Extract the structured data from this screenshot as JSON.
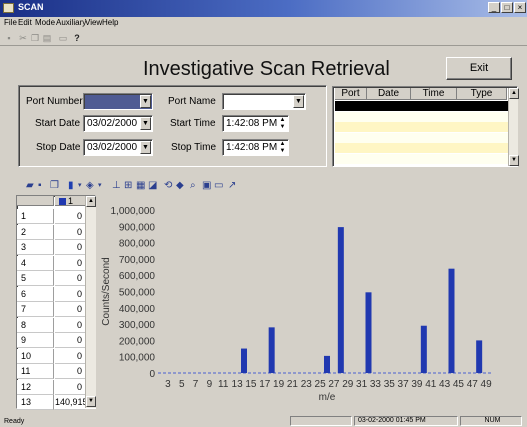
{
  "window": {
    "title": "SCAN",
    "controls": {
      "minimize": "_",
      "maximize": "□",
      "close": "×"
    }
  },
  "menu": [
    "File",
    "Edit",
    "Mode",
    "Auxiliary",
    "View",
    "Help"
  ],
  "header": {
    "title": "Investigative Scan Retrieval",
    "exit_label": "Exit"
  },
  "form": {
    "port_number": {
      "label": "Port Number",
      "value": ""
    },
    "port_name": {
      "label": "Port Name",
      "value": ""
    },
    "start_date": {
      "label": "Start Date",
      "value": "03/02/2000"
    },
    "start_time": {
      "label": "Start Time",
      "value": "1:42:08 PM"
    },
    "stop_date": {
      "label": "Stop Date",
      "value": "03/02/2000"
    },
    "stop_time": {
      "label": "Stop Time",
      "value": "1:42:08 PM"
    }
  },
  "results_grid": {
    "columns": [
      "Port",
      "Date",
      "Time",
      "Type"
    ],
    "row_colors": [
      "#000000",
      "#fffff0",
      "#fff6c4",
      "#fffff0",
      "#fff6c4",
      "#fffff0"
    ]
  },
  "data_table": {
    "column_header": "1",
    "rows": [
      [
        "1",
        "0"
      ],
      [
        "2",
        "0"
      ],
      [
        "3",
        "0"
      ],
      [
        "4",
        "0"
      ],
      [
        "5",
        "0"
      ],
      [
        "6",
        "0"
      ],
      [
        "7",
        "0"
      ],
      [
        "8",
        "0"
      ],
      [
        "9",
        "0"
      ],
      [
        "10",
        "0"
      ],
      [
        "11",
        "0"
      ],
      [
        "12",
        "0"
      ],
      [
        "13",
        "140,915"
      ]
    ]
  },
  "chart_data": {
    "type": "bar",
    "xlabel": "m/e",
    "ylabel": "Counts/Second",
    "ylim": [
      0,
      1000000
    ],
    "yticks": [
      "0",
      "100,000",
      "200,000",
      "300,000",
      "400,000",
      "500,000",
      "600,000",
      "700,000",
      "800,000",
      "900,000",
      "1,000,000"
    ],
    "xticks": [
      "3",
      "5",
      "7",
      "9",
      "11",
      "13",
      "15",
      "17",
      "19",
      "21",
      "23",
      "25",
      "27",
      "29",
      "31",
      "33",
      "35",
      "37",
      "39",
      "41",
      "43",
      "45",
      "47",
      "49"
    ],
    "bars": [
      {
        "x": 14,
        "value": 150000
      },
      {
        "x": 18,
        "value": 280000
      },
      {
        "x": 26,
        "value": 105000
      },
      {
        "x": 28,
        "value": 895000
      },
      {
        "x": 32,
        "value": 495000
      },
      {
        "x": 40,
        "value": 290000
      },
      {
        "x": 44,
        "value": 640000
      },
      {
        "x": 48,
        "value": 200000
      }
    ],
    "bar_color": "#2038b0",
    "baseline_color": "#4a60d0"
  },
  "status": {
    "left": "Ready",
    "datetime": "03-02-2000 01:45 PM",
    "num": "NUM"
  }
}
